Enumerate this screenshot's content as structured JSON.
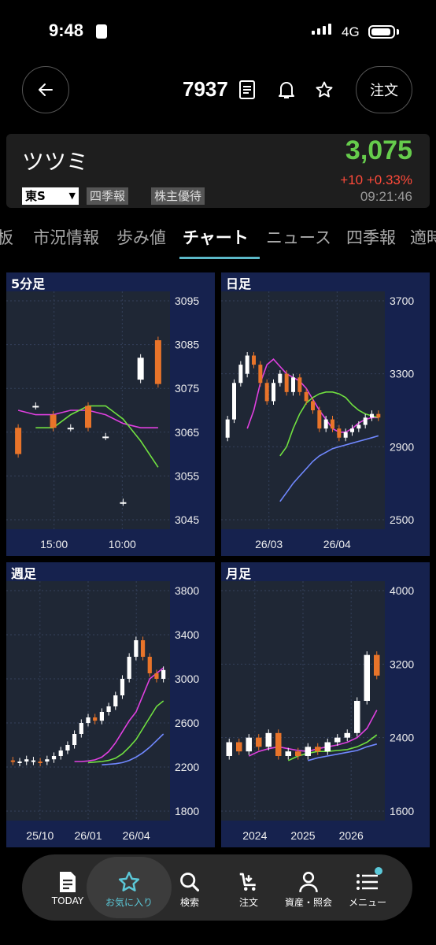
{
  "status": {
    "time": "9:48",
    "network": "4G"
  },
  "header": {
    "code": "7937",
    "order_label": "注文"
  },
  "stock": {
    "name": "ツツミ",
    "price": "3,075",
    "change": "+10  +0.33%",
    "time": "09:21:46",
    "exchange": "東S",
    "tags": [
      "四季報",
      "株主優待"
    ]
  },
  "tabs": [
    "板",
    "市況情報",
    "歩み値",
    "チャート",
    "ニュース",
    "四季報",
    "適時"
  ],
  "active_tab": "チャート",
  "colors": {
    "accent": "#5bb8c8",
    "up": "#66cc4c",
    "down": "#ff4a3a",
    "panel": "#16224e",
    "plot": "#1f2735",
    "candle_up": "#ffffff",
    "candle_down": "#e8742a",
    "ma_short": "#e040e0",
    "ma_mid": "#70e040",
    "ma_long": "#7088ff"
  },
  "panels": {
    "min5": {
      "title": "5分足",
      "yticks": [
        "3095",
        "3085",
        "3075",
        "3065",
        "3055",
        "3045"
      ],
      "xticks": [
        "15:00",
        "10:00"
      ]
    },
    "daily": {
      "title": "日足",
      "yticks": [
        "3700",
        "3300",
        "2900",
        "2500"
      ],
      "xticks": [
        "26/03",
        "26/04"
      ]
    },
    "weekly": {
      "title": "週足",
      "yticks": [
        "3800",
        "3400",
        "3000",
        "2600",
        "2200",
        "1800"
      ],
      "xticks": [
        "25/10",
        "26/01",
        "26/04"
      ]
    },
    "monthly": {
      "title": "月足",
      "yticks": [
        "4000",
        "3200",
        "2400",
        "1600"
      ],
      "xticks": [
        "2024",
        "2025",
        "2026"
      ]
    }
  },
  "chart_data": [
    {
      "type": "line",
      "title": "5分足",
      "ylim": [
        3045,
        3095
      ],
      "candles": [
        [
          3066,
          3060
        ],
        [
          3071,
          3071
        ],
        [
          3069,
          3066
        ],
        [
          3066,
          3066
        ],
        [
          3071,
          3066
        ],
        [
          3064,
          3064
        ],
        [
          3049,
          3049
        ],
        [
          3077,
          3082
        ],
        [
          3086,
          3076
        ]
      ],
      "series": [
        {
          "values": [
            3070,
            3069,
            3069,
            3070,
            3070,
            3069,
            3067,
            3066,
            3066
          ]
        },
        {
          "values": [
            3066,
            3066,
            3069,
            3071,
            3071,
            3068,
            3063,
            3057
          ]
        }
      ]
    },
    {
      "type": "line",
      "title": "日足",
      "ylim": [
        2500,
        3700
      ],
      "candles": [
        [
          2950,
          3050
        ],
        [
          3050,
          3250
        ],
        [
          3250,
          3350
        ],
        [
          3300,
          3400
        ],
        [
          3400,
          3350
        ],
        [
          3350,
          3250
        ],
        [
          3250,
          3150
        ],
        [
          3150,
          3250
        ],
        [
          3250,
          3300
        ],
        [
          3300,
          3200
        ],
        [
          3200,
          3280
        ],
        [
          3280,
          3200
        ],
        [
          3200,
          3150
        ],
        [
          3150,
          3100
        ],
        [
          3100,
          3000
        ],
        [
          3000,
          3050
        ],
        [
          3050,
          3000
        ],
        [
          3000,
          2950
        ],
        [
          2950,
          2980
        ],
        [
          2980,
          3000
        ],
        [
          3000,
          3020
        ],
        [
          3020,
          3060
        ],
        [
          3060,
          3080
        ],
        [
          3080,
          3060
        ]
      ],
      "series": [
        {
          "values": [
            3000,
            3100,
            3250,
            3350,
            3380,
            3340,
            3300,
            3280,
            3260,
            3220,
            3160,
            3100,
            3050,
            3000,
            2980,
            2980,
            3000,
            3030,
            3050,
            3060,
            3060
          ]
        },
        {
          "values": [
            2850,
            2900,
            3000,
            3080,
            3140,
            3170,
            3190,
            3200,
            3200,
            3190,
            3170,
            3130,
            3100,
            3080,
            3070,
            3060
          ]
        },
        {
          "values": [
            2600,
            2650,
            2700,
            2740,
            2780,
            2820,
            2850,
            2870,
            2890,
            2900,
            2910,
            2920,
            2930,
            2940,
            2950,
            2960
          ]
        }
      ]
    },
    {
      "type": "line",
      "title": "週足",
      "ylim": [
        1800,
        3800
      ],
      "candles": [
        [
          2260,
          2250
        ],
        [
          2240,
          2250
        ],
        [
          2250,
          2270
        ],
        [
          2250,
          2260
        ],
        [
          2250,
          2240
        ],
        [
          2250,
          2270
        ],
        [
          2270,
          2300
        ],
        [
          2300,
          2350
        ],
        [
          2350,
          2400
        ],
        [
          2400,
          2500
        ],
        [
          2500,
          2600
        ],
        [
          2600,
          2650
        ],
        [
          2650,
          2620
        ],
        [
          2620,
          2700
        ],
        [
          2700,
          2750
        ],
        [
          2750,
          2850
        ],
        [
          2850,
          3000
        ],
        [
          3000,
          3200
        ],
        [
          3200,
          3350
        ],
        [
          3350,
          3200
        ],
        [
          3200,
          3050
        ],
        [
          3050,
          3000
        ],
        [
          3000,
          3080
        ]
      ],
      "series": [
        {
          "values": [
            2250,
            2250,
            2255,
            2265,
            2290,
            2340,
            2420,
            2520,
            2620,
            2700,
            2850,
            3000,
            3050,
            3100
          ]
        },
        {
          "values": [
            2240,
            2245,
            2250,
            2260,
            2280,
            2320,
            2380,
            2450,
            2550,
            2650,
            2750,
            2800
          ]
        },
        {
          "values": [
            2220,
            2225,
            2230,
            2240,
            2260,
            2290,
            2330,
            2380,
            2440,
            2500
          ]
        }
      ]
    },
    {
      "type": "line",
      "title": "月足",
      "ylim": [
        1600,
        4000
      ],
      "candles": [
        [
          2200,
          2350
        ],
        [
          2350,
          2250
        ],
        [
          2250,
          2400
        ],
        [
          2400,
          2300
        ],
        [
          2300,
          2450
        ],
        [
          2450,
          2200
        ],
        [
          2200,
          2250
        ],
        [
          2250,
          2200
        ],
        [
          2200,
          2300
        ],
        [
          2300,
          2250
        ],
        [
          2250,
          2350
        ],
        [
          2350,
          2400
        ],
        [
          2400,
          2450
        ],
        [
          2450,
          2800
        ],
        [
          2800,
          3300
        ],
        [
          3300,
          3075
        ]
      ],
      "series": [
        {
          "values": [
            2200,
            2250,
            2280,
            2300,
            2280,
            2260,
            2250,
            2280,
            2300,
            2320,
            2350,
            2400,
            2500,
            2700
          ]
        },
        {
          "values": [
            2150,
            2200,
            2230,
            2250,
            2250,
            2260,
            2270,
            2300,
            2350,
            2430
          ]
        },
        {
          "values": [
            2150,
            2180,
            2200,
            2220,
            2240,
            2260,
            2300,
            2330
          ]
        }
      ]
    }
  ],
  "nav": [
    {
      "label": "TODAY",
      "icon": "document-icon"
    },
    {
      "label": "お気に入り",
      "icon": "star-icon"
    },
    {
      "label": "検索",
      "icon": "search-icon"
    },
    {
      "label": "注文",
      "icon": "cart-icon"
    },
    {
      "label": "資産・照会",
      "icon": "person-icon"
    },
    {
      "label": "メニュー",
      "icon": "menu-icon"
    }
  ]
}
